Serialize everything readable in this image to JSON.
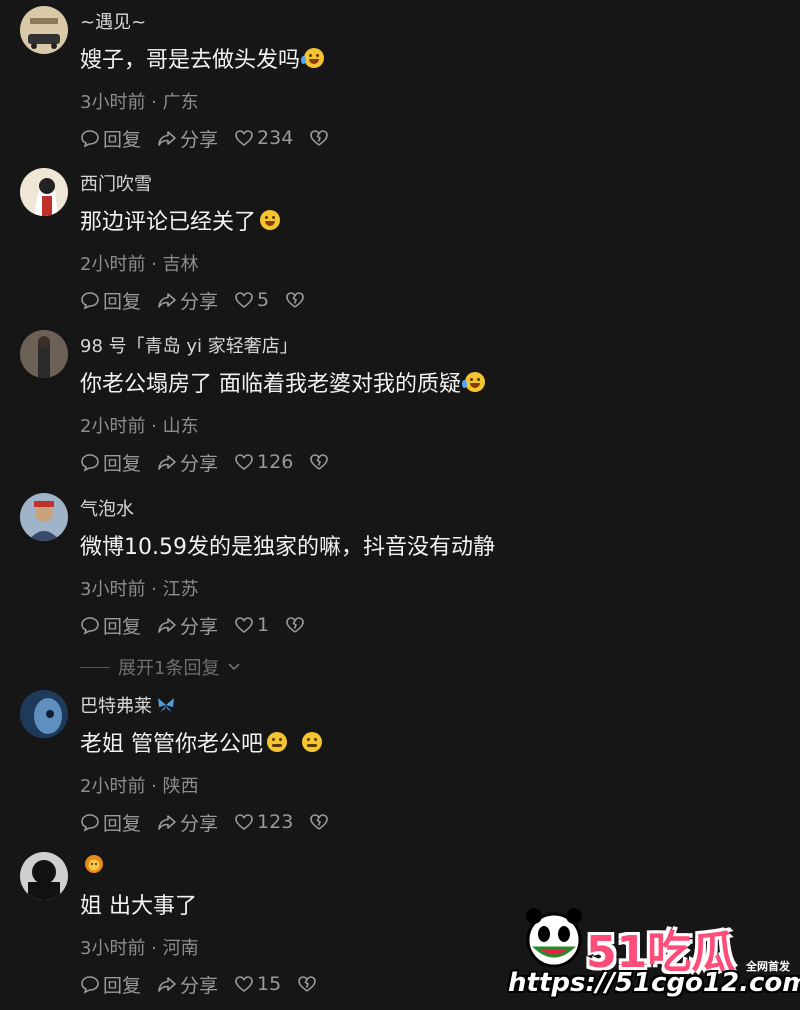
{
  "actions": {
    "reply": "回复",
    "share": "分享"
  },
  "comments": [
    {
      "username": "~遇见~",
      "text": "嫂子，哥是去做头发吗",
      "emoji": "cry",
      "emoji2": "",
      "time": "3小时前",
      "location": "广东",
      "likes": "234",
      "avatar": "logo"
    },
    {
      "username": "西门吹雪",
      "text": "那边评论已经关了",
      "emoji": "smile",
      "emoji2": "",
      "time": "2小时前",
      "location": "吉林",
      "likes": "5",
      "avatar": "art"
    },
    {
      "username": "98 号「青岛 yi 家轻奢店」",
      "text": "你老公塌房了  面临着我老婆对我的质疑",
      "emoji": "cry",
      "emoji2": "",
      "time": "2小时前",
      "location": "山东",
      "likes": "126",
      "avatar": "photo"
    },
    {
      "username": "气泡水",
      "text": "微博10.59发的是独家的嘛，抖音没有动静",
      "emoji": "",
      "emoji2": "",
      "time": "3小时前",
      "location": "江苏",
      "likes": "1",
      "avatar": "person"
    },
    {
      "username": "巴特弗莱",
      "text": "老姐 管管你老公吧",
      "emoji": "worry",
      "emoji2": "worry",
      "time": "2小时前",
      "location": "陕西",
      "likes": "123",
      "avatar": "blue",
      "badge": "butterfly-icon"
    },
    {
      "username": "",
      "text": "姐 出大事了",
      "emoji": "",
      "emoji2": "",
      "time": "3小时前",
      "location": "河南",
      "likes": "15",
      "avatar": "dark",
      "badge": "lion-icon"
    }
  ],
  "expand_replies": "展开1条回复",
  "watermark": {
    "brand": "51吃瓜",
    "tag": "全网首发",
    "url": "https://51cgo12.com"
  },
  "colors": {
    "background": "#161616",
    "text": "#f2f2f2",
    "meta": "#8d8d8d",
    "brand": "#ff4d7a"
  }
}
